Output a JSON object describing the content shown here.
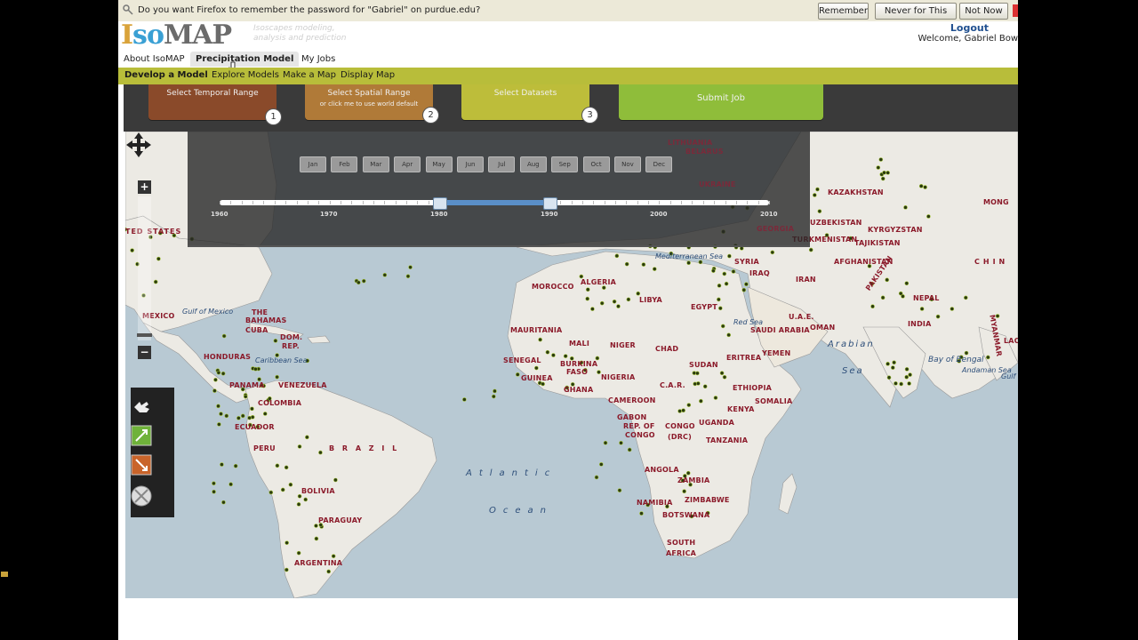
{
  "password_bar": {
    "message": "Do you want Firefox to remember the password for \"Gabriel\" on purdue.edu?",
    "remember": "Remember",
    "never": "Never for This Site",
    "not_now": "Not Now"
  },
  "header": {
    "logo": "IsoMAP",
    "tagline": "Isoscapes modeling, analysis and prediction",
    "logout": "Logout",
    "welcome": "Welcome, Gabriel Bow"
  },
  "tabs": [
    "About IsoMAP",
    "Precipitation Model",
    "My Jobs"
  ],
  "subnav": [
    "Develop a Model",
    "Explore Models",
    "Make a Map",
    "Display Map"
  ],
  "steps": [
    {
      "label": "Select Temporal Range",
      "sub": "",
      "num": "1",
      "color": "#8a4a2a"
    },
    {
      "label": "Select Spatial Range",
      "sub": "or click me to use world default",
      "num": "2",
      "color": "#b07a38"
    },
    {
      "label": "Select Datasets",
      "sub": "",
      "num": "3",
      "color": "#bdbd3a"
    },
    {
      "label": "Submit Job",
      "sub": "",
      "num": "",
      "color": "#8fbd3a"
    }
  ],
  "months": [
    "Jan",
    "Feb",
    "Mar",
    "Apr",
    "May",
    "Jun",
    "Jul",
    "Aug",
    "Sep",
    "Oct",
    "Nov",
    "Dec"
  ],
  "years": [
    "1960",
    "1970",
    "1980",
    "1990",
    "2000",
    "2010"
  ],
  "slider": {
    "min": 1960,
    "max": 2010,
    "start": 1980,
    "end": 1990
  },
  "zoom": {
    "plus": "+",
    "minus": "−"
  },
  "map_labels": {
    "countries": [
      "KAZAKHSTAN",
      "MONG",
      "UZBEKISTAN",
      "KYRGYZSTAN",
      "TURKMENISTAN",
      "TAJIKISTAN",
      "AFGHANISTAN",
      "CHIN",
      "IRAN",
      "PAKISTAN",
      "NEPAL",
      "INDIA",
      "U.A.E.",
      "OMAN",
      "SAUDI ARABIA",
      "YEMEN",
      "IRAQ",
      "SYRIA",
      "EGYPT",
      "LIBYA",
      "ALGERIA",
      "MOROCCO",
      "MAURITANIA",
      "MALI",
      "NIGER",
      "CHAD",
      "SUDAN",
      "ERITREA",
      "ETHIOPIA",
      "SOMALIA",
      "KENYA",
      "SENEGAL",
      "BURKINA",
      "FASO",
      "GUINEA",
      "GHANA",
      "NIGERIA",
      "C.A.R.",
      "CAMEROON",
      "GABON",
      "REP. OF",
      "CONGO",
      "CONGO",
      "(DRC)",
      "UGANDA",
      "TANZANIA",
      "ANGOLA",
      "ZAMBIA",
      "ZIMBABWE",
      "NAMIBIA",
      "BOTSWANA",
      "SOUTH",
      "AFRICA",
      "MEXICO",
      "THE",
      "BAHAMAS",
      "CUBA",
      "DOM.",
      "REP.",
      "HONDURAS",
      "PANAMA",
      "VENEZUELA",
      "COLOMBIA",
      "ECUADOR",
      "PERU",
      "B R A Z I L",
      "BOLIVIA",
      "PARAGUAY",
      "ARGENTINA",
      "TED STATES",
      "MYANMAR",
      "LAOS",
      "LITHUANIA",
      "BELARUS",
      "UKRAINE",
      "GEORGIA"
    ],
    "seas": [
      "Gulf of Mexico",
      "Caribbean Sea",
      "Mediterranean Sea",
      "Red Sea",
      "Bay of Bengal",
      "Andaman Sea",
      "Gulf of Thailand"
    ],
    "oceans": [
      "Atlantic",
      "Ocean",
      "Arabian",
      "Sea"
    ]
  }
}
